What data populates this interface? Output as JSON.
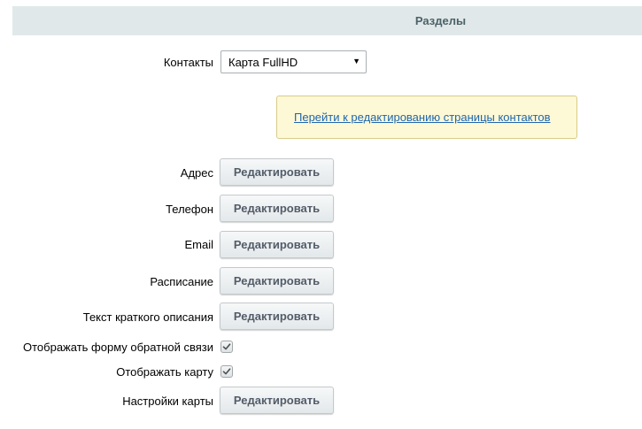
{
  "section": {
    "title": "Разделы"
  },
  "contacts": {
    "label": "Контакты",
    "selected_value": "Карта FullHD",
    "arrow_glyph": "▼"
  },
  "notice": {
    "link_text": "Перейти к редактированию страницы контактов"
  },
  "fields": [
    {
      "label": "Адрес",
      "button_label": "Редактировать"
    },
    {
      "label": "Телефон",
      "button_label": "Редактировать"
    },
    {
      "label": "Email",
      "button_label": "Редактировать"
    },
    {
      "label": "Расписание",
      "button_label": "Редактировать"
    },
    {
      "label": "Текст краткого описания",
      "button_label": "Редактировать"
    }
  ],
  "options": [
    {
      "label": "Отображать форму обратной связи",
      "checked": true
    },
    {
      "label": "Отображать карту",
      "checked": true
    }
  ],
  "map_settings": {
    "label": "Настройки карты",
    "button_label": "Редактировать"
  },
  "colors": {
    "header_bg": "#e0e8ea",
    "header_text": "#4b6267",
    "notice_bg": "#fdf8d5",
    "link": "#2067b0",
    "button_text": "#535c69"
  }
}
